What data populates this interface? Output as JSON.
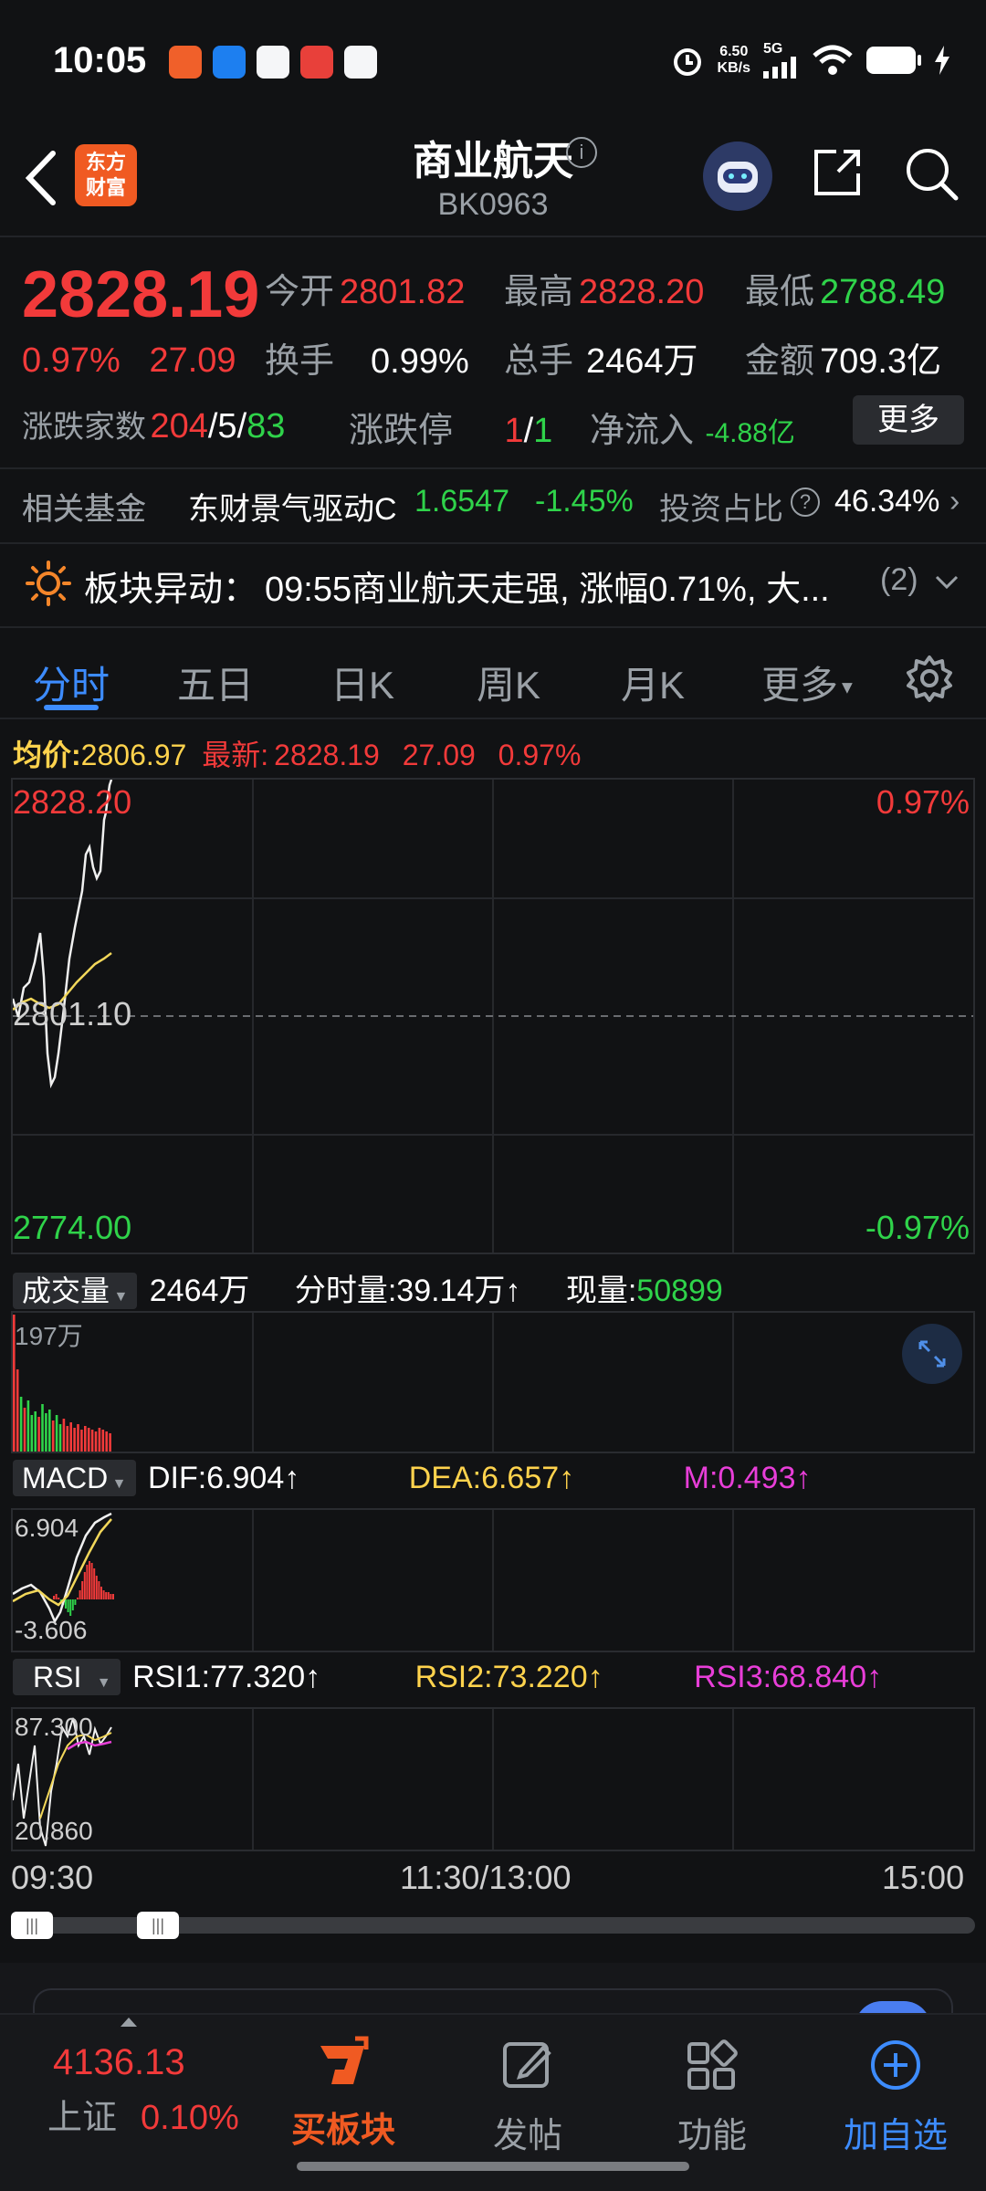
{
  "status_bar": {
    "time": "10:05",
    "net_speed_value": "6.50",
    "net_speed_unit": "KB/s",
    "network": "5G",
    "icons": [
      "alarm-icon",
      "signal-icon",
      "wifi-icon",
      "battery-icon",
      "charging-icon"
    ]
  },
  "header": {
    "logo_text_line1": "东方",
    "logo_text_line2": "财富",
    "title": "商业航天",
    "code": "BK0963",
    "info_icon": "i"
  },
  "quote": {
    "price": "2828.19",
    "change_pct": "0.97%",
    "change_abs": "27.09",
    "open_label": "今开",
    "open": "2801.82",
    "high_label": "最高",
    "high": "2828.20",
    "low_label": "最低",
    "low": "2788.49",
    "turnover_label": "换手",
    "turnover": "0.99%",
    "volume_label": "总手",
    "volume": "2464万",
    "amount_label": "金额",
    "amount": "709.3亿",
    "adv_dec_label": "涨跌家数",
    "adv": "204",
    "flat": "5",
    "dec": "83",
    "sep": "/",
    "limit_label": "涨跌停",
    "limit_up": "1",
    "limit_down": "1",
    "netflow_label": "净流入",
    "netflow": "-4.88亿",
    "more_button": "更多"
  },
  "fund": {
    "label": "相关基金",
    "name": "东财景气驱动C",
    "nav": "1.6547",
    "chg": "-1.45%",
    "ratio_label": "投资占比",
    "ratio": "46.34%"
  },
  "alert": {
    "label": "板块异动：",
    "text": "09:55商业航天走强, 涨幅0.71%, 大...",
    "count": "(2)"
  },
  "tabs": [
    "分时",
    "五日",
    "日K",
    "周K",
    "月K",
    "更多"
  ],
  "intraday": {
    "avg_label": "均价:",
    "avg": "2806.97",
    "latest_label": "最新:",
    "latest": "2828.19",
    "chg": "27.09",
    "pct": "0.97%",
    "y_high": "2828.20",
    "y_mid": "2801.10",
    "y_low": "2774.00",
    "pct_high": "0.97%",
    "pct_low": "-0.97%"
  },
  "volume_panel": {
    "selector": "成交量",
    "total": "2464万",
    "minute_label": "分时量:",
    "minute": "39.14万",
    "current_label": "现量:",
    "current": "50899",
    "y_max": "197万",
    "arrow": "↑"
  },
  "macd_panel": {
    "selector": "MACD",
    "dif_label": "DIF:",
    "dif": "6.904",
    "dea_label": "DEA:",
    "dea": "6.657",
    "m_label": "M:",
    "m": "0.493",
    "y_max": "6.904",
    "y_min": "-3.606"
  },
  "rsi_panel": {
    "selector": "RSI",
    "rsi1_label": "RSI1:",
    "rsi1": "77.320",
    "rsi2_label": "RSI2:",
    "rsi2": "73.220",
    "rsi3_label": "RSI3:",
    "rsi3": "68.840",
    "y_max": "87.300",
    "y_min": "20.860"
  },
  "time_axis": [
    "09:30",
    "11:30/13:00",
    "15:00"
  ],
  "bottom_bar": {
    "index_value": "4136.13",
    "index_name": "上证",
    "index_pct": "0.10%",
    "buy_sector": "买板块",
    "post": "发帖",
    "functions": "功能",
    "add_watch": "加自选"
  },
  "colors": {
    "up": "#f23a3a",
    "down": "#2fd34a",
    "accent": "#3d8cff",
    "yellow": "#ffd34d",
    "magenta": "#e83ed8"
  }
}
